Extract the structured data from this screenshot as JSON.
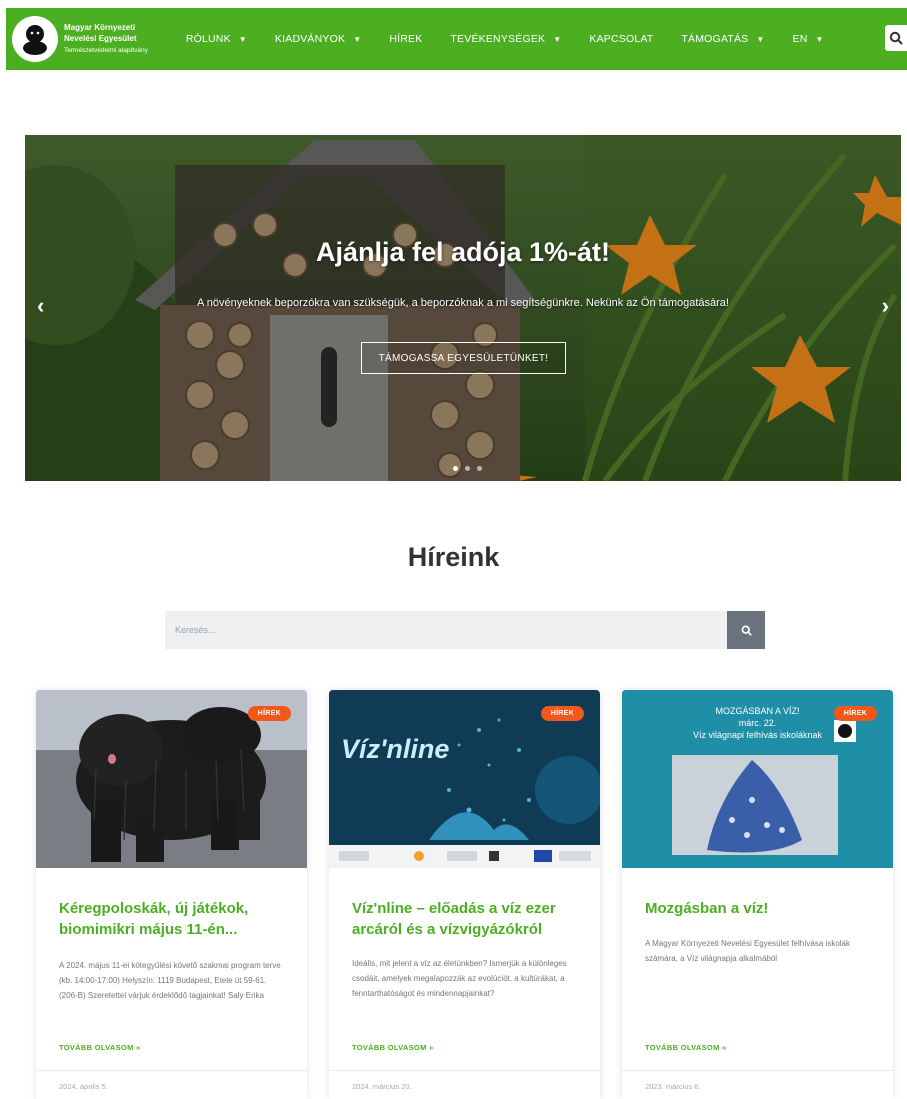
{
  "header": {
    "logo_line1": "Magyar Környezeti",
    "logo_line2": "Nevelési Egyesület",
    "logo_line3": "Természetvédelmi alapítvány",
    "nav": [
      {
        "label": "RÓLUNK",
        "has_dropdown": true
      },
      {
        "label": "KIADVÁNYOK",
        "has_dropdown": true
      },
      {
        "label": "HÍREK",
        "has_dropdown": false
      },
      {
        "label": "TEVÉKENYSÉGEK",
        "has_dropdown": true
      },
      {
        "label": "KAPCSOLAT",
        "has_dropdown": false
      },
      {
        "label": "TÁMOGATÁS",
        "has_dropdown": true
      },
      {
        "label": "EN",
        "has_dropdown": true
      }
    ],
    "search_icon": "search-icon",
    "color": "#4caf22"
  },
  "hero": {
    "title": "Ajánlja fel adója 1%-át!",
    "subtitle": "A növényeknek beporzókra van szükségük, a beporzóknak a mi segítségünkre. Nekünk az Ön támogatására!",
    "button": "TÁMOGASSA EGYESÜLETÜNKET!",
    "prev_icon": "chevron-left-icon",
    "next_icon": "chevron-right-icon",
    "slide_count": 3,
    "active_slide": 1
  },
  "news": {
    "title": "Híreink",
    "search_placeholder": "Keresés...",
    "accent_color": "#f3571c",
    "cards": [
      {
        "badge": "HÍREK",
        "title": "Kéregpoloskák, új játékok, biomimikri május 11-én...",
        "excerpt": "A 2024. május 11-ei kötegyűlési követő szakmai program terve (kb. 14:00-17:00) Helyszín: 1119 Budapest, Etele út 59-61. (206-B) Szeretettel várjuk érdeklődő tagjainkat! Saly Erika",
        "read_more": "TOVÁBB OLVASOM »",
        "date": "2024. április 5."
      },
      {
        "badge": "HÍREK",
        "image_title": "Víz'nline",
        "title": "Víz'nline – előadás a víz ezer arcáról és a vízvigyázókról",
        "excerpt": "Ideális, mit jelent a víz az életünkben? Ismerjük a különleges csodáit, amelyek megalapozzák az evolúciót, a kultúrákat, a fenntarthatóságot és mindennapjainkat?",
        "read_more": "TOVÁBB OLVASOM »",
        "date": "2024. március 20."
      },
      {
        "badge": "HÍREK",
        "image_title": "MOZGÁSBAN A VÍZ!",
        "image_line2": "márc. 22.",
        "image_line3": "Víz világnapi felhívás iskoláknak",
        "title": "Mozgásban a víz!",
        "excerpt": "A Magyar Környezeti Nevelési Egyesület felhívása iskolák számára, a Víz világnapja alkalmából",
        "read_more": "TOVÁBB OLVASOM »",
        "date": "2023. március 6."
      }
    ]
  }
}
